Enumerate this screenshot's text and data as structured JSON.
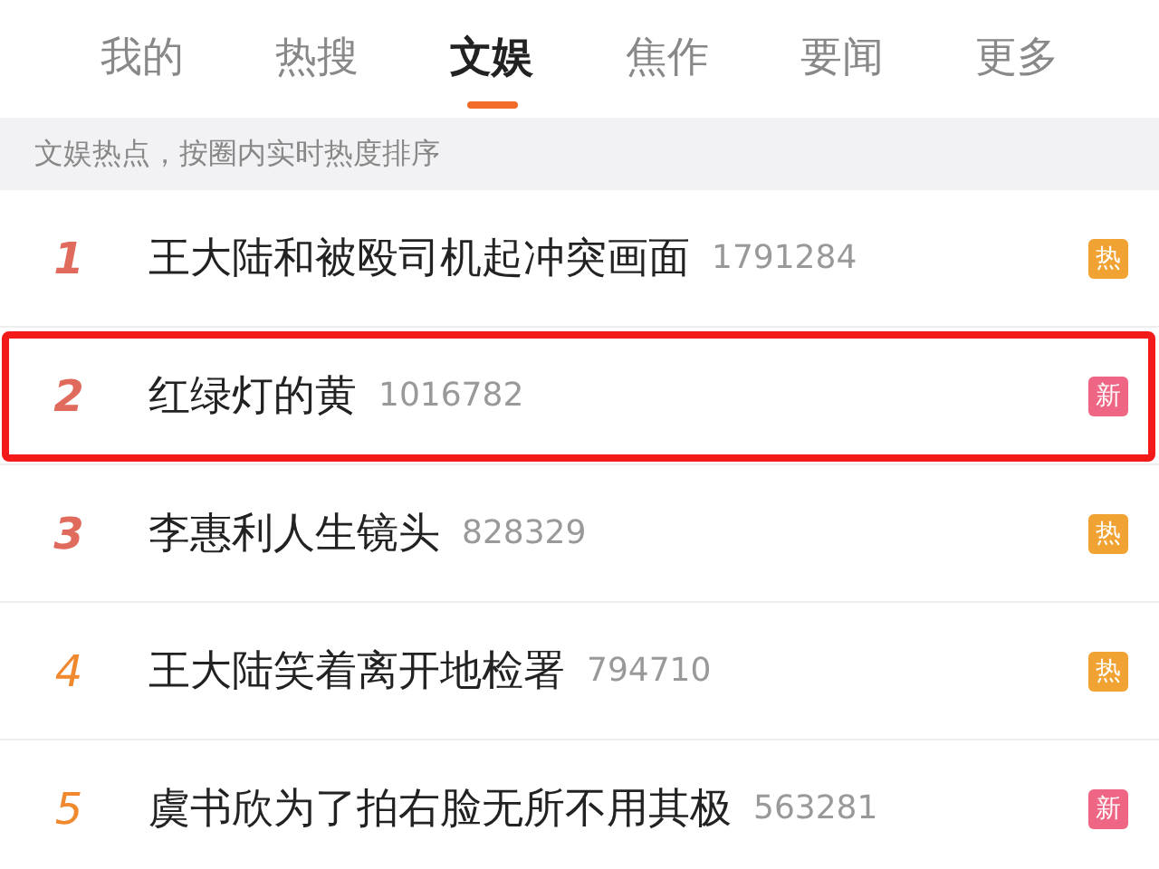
{
  "tabs": [
    {
      "label": "我的",
      "selected": false
    },
    {
      "label": "热搜",
      "selected": false
    },
    {
      "label": "文娱",
      "selected": true
    },
    {
      "label": "焦作",
      "selected": false
    },
    {
      "label": "要闻",
      "selected": false
    },
    {
      "label": "更多",
      "selected": false
    }
  ],
  "subheader": "文娱热点，按圈内实时热度排序",
  "rows": [
    {
      "rank": "1",
      "kind": "top",
      "color": "#e06a5c",
      "title": "王大陆和被殴司机起冲突画面",
      "count": "1791284",
      "badge": {
        "text": "热",
        "kind": "hot"
      },
      "highlighted": false
    },
    {
      "rank": "2",
      "kind": "top",
      "color": "#e06a5c",
      "title": "红绿灯的黄",
      "count": "1016782",
      "badge": {
        "text": "新",
        "kind": "new"
      },
      "highlighted": true
    },
    {
      "rank": "3",
      "kind": "top",
      "color": "#e06a5c",
      "title": "李惠利人生镜头",
      "count": "828329",
      "badge": {
        "text": "热",
        "kind": "hot"
      },
      "highlighted": false
    },
    {
      "rank": "4",
      "kind": "normal",
      "color": "#f0882e",
      "title": "王大陆笑着离开地检署",
      "count": "794710",
      "badge": {
        "text": "热",
        "kind": "hot"
      },
      "highlighted": false
    },
    {
      "rank": "5",
      "kind": "normal",
      "color": "#f0882e",
      "title": "虞书欣为了拍右脸无所不用其极",
      "count": "563281",
      "badge": {
        "text": "新",
        "kind": "new"
      },
      "highlighted": false
    }
  ]
}
